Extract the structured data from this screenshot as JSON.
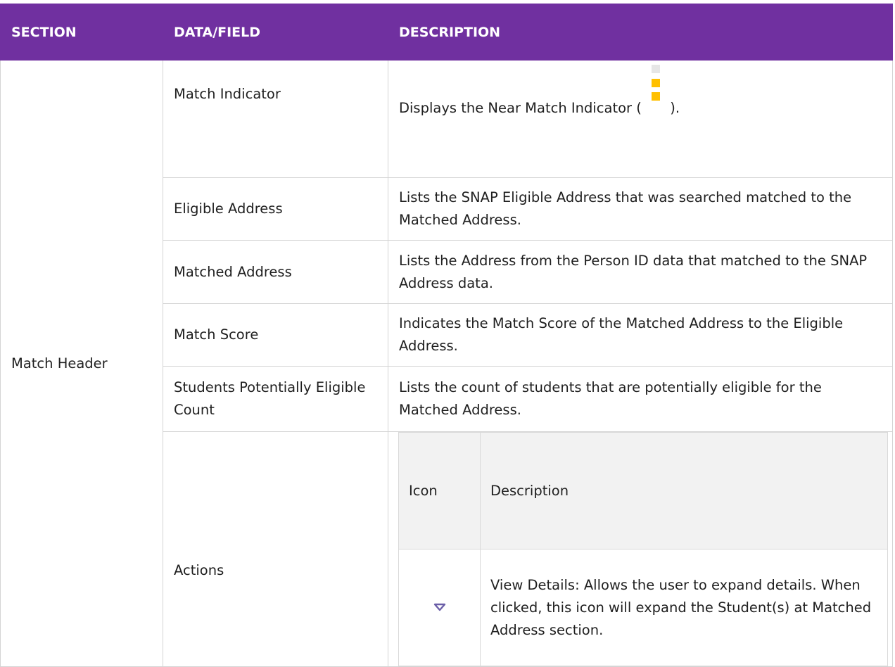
{
  "table": {
    "headers": [
      "SECTION",
      "DATA/FIELD",
      "DESCRIPTION"
    ],
    "section_label": "Match Header",
    "rows": [
      {
        "field": "Match Indicator",
        "description_before": "Displays the Near Match Indicator (",
        "description_after": ")."
      },
      {
        "field": "Eligible Address",
        "description": "Lists the SNAP Eligible Address that was searched matched to the Matched Address."
      },
      {
        "field": "Matched Address",
        "description": "Lists the Address from the Person ID data that matched to the SNAP Address data."
      },
      {
        "field": "Match Score",
        "description": "Indicates the Match Score of the Matched Address to the Eligible Address."
      },
      {
        "field": "Students Potentially Eligible Count",
        "description": "Lists the count of students that are potentially eligible for the Matched Address."
      },
      {
        "field": "Actions"
      }
    ],
    "actions_table": {
      "headers": [
        "Icon",
        "Description"
      ],
      "rows": [
        {
          "icon": "chevron-down-icon",
          "description": "View Details: Allows the user to expand details. When clicked, this icon will expand the Student(s) at Matched Address section."
        }
      ]
    }
  },
  "icons": {
    "near_match_indicator": "near-match-indicator-icon"
  },
  "colors": {
    "header_bg": "#7030a0",
    "header_text": "#ffffff",
    "indicator_active": "#ffc000",
    "indicator_inactive": "#e6e6e6",
    "chevron": "#6b5fa8",
    "subheader_bg": "#f2f2f2"
  }
}
